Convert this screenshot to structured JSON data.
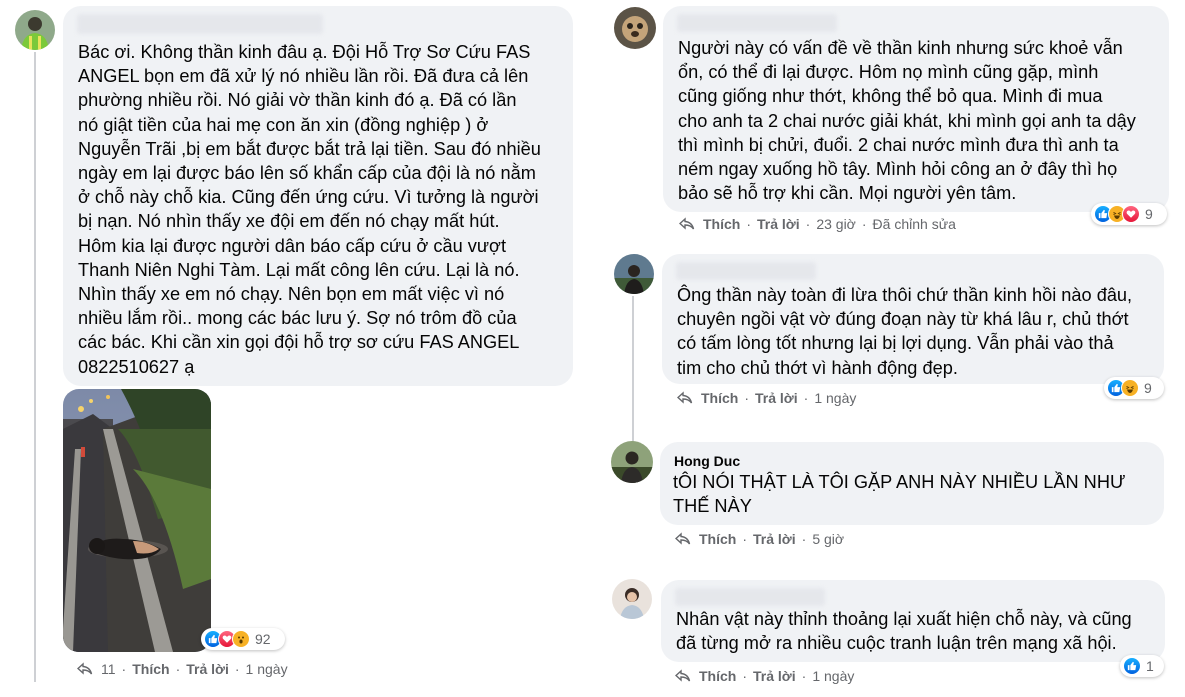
{
  "left_column": {
    "comment": {
      "author": "",
      "text": "Bác ơi. Không thần kinh đâu ạ. Đội Hỗ Trợ Sơ Cứu FAS\nANGEL bọn em đã xử lý nó nhiều lần rồi. Đã đưa cả lên\nphường nhiều rồi. Nó giải vờ thần kinh đó ạ. Đã có lần\nnó giật tiền của hai mẹ con ăn xin (đồng nghiệp ) ở\nNguyễn Trãi ,bị em bắt được bắt trả lại tiền. Sau đó nhiều\nngày em lại được báo lên số khẩn cấp của đội là nó nằm\nở chỗ này chỗ kia. Cũng đến ứng cứu. Vì tưởng là người\nbị nạn. Nó nhìn thấy xe đội em đến nó chạy mất hút.\nHôm kia lại được người dân báo cấp cứu ở cầu vượt\nThanh Niên Nghi Tàm. Lại mất công lên cứu. Lại là nó.\nNhìn thấy xe em nó chạy. Nên bọn em mất việc vì nó\nnhiều lắm rồi.. mong các bác lưu ý. Sợ nó trôm đồ của\ncác bác. Khi cần xin gọi đội hỗ trợ sơ cứu FAS ANGEL\n0822510627 ạ",
      "reaction_count": "92",
      "reply_count": "11",
      "like_label": "Thích",
      "reply_label": "Trả lời",
      "time": "1 ngày"
    }
  },
  "right_column": {
    "comments": [
      {
        "author": "",
        "text": "Người này có vấn đề về thần kinh nhưng sức khoẻ vẫn\nổn, có thể đi lại được. Hôm nọ mình cũng gặp, mình\ncũng giống như thớt, không thể bỏ qua. Mình đi mua\ncho anh ta 2 chai nước giải khát, khi mình gọi anh ta dậy\nthì mình bị chửi, đuổi. 2 chai nước mình đưa thì anh ta\nném ngay xuống hồ tây. Mình hỏi công an ở đây thì họ\nbảo sẽ hỗ trợ khi cần. Mọi người yên tâm.",
        "like_label": "Thích",
        "reply_label": "Trả lời",
        "time": "23 giờ",
        "edited": "Đã chỉnh sửa",
        "reaction_count": "9"
      },
      {
        "author": "",
        "text": "Ông thần này toàn đi lừa thôi chứ thần kinh hồi nào đâu,\nchuyên ngồi vật vờ đúng đoạn này từ khá lâu r, chủ thớt\ncó tấm lòng tốt nhưng lại bị lợi dụng. Vẫn phải vào thả\ntim cho chủ thớt vì hành động đẹp.",
        "like_label": "Thích",
        "reply_label": "Trả lời",
        "time": "1 ngày",
        "reaction_count": "9"
      },
      {
        "author": "Hong Duc",
        "text": "tÔI NÓI THẬT LÀ TÔI GẶP ANH NÀY NHIỀU LẦN NHƯ\nTHẾ NÀY",
        "like_label": "Thích",
        "reply_label": "Trả lời",
        "time": "5 giờ"
      },
      {
        "author": "",
        "text": "Nhân vật này thỉnh thoảng lại xuất hiện chỗ này, và cũng\nđã từng mở ra nhiều cuộc tranh luận trên mạng xã hội.",
        "like_label": "Thích",
        "reply_label": "Trả lời",
        "time": "1 ngày",
        "reaction_count": "1"
      }
    ]
  },
  "colors": {
    "bubble": "#f0f2f5",
    "muted_text": "#65676b",
    "like_blue": "#1877f2",
    "love_red": "#f33e58",
    "haha_yellow": "#f7b125"
  },
  "icons": [
    "reply-icon",
    "like-reaction-icon",
    "haha-reaction-icon",
    "love-reaction-icon",
    "wow-reaction-icon"
  ]
}
